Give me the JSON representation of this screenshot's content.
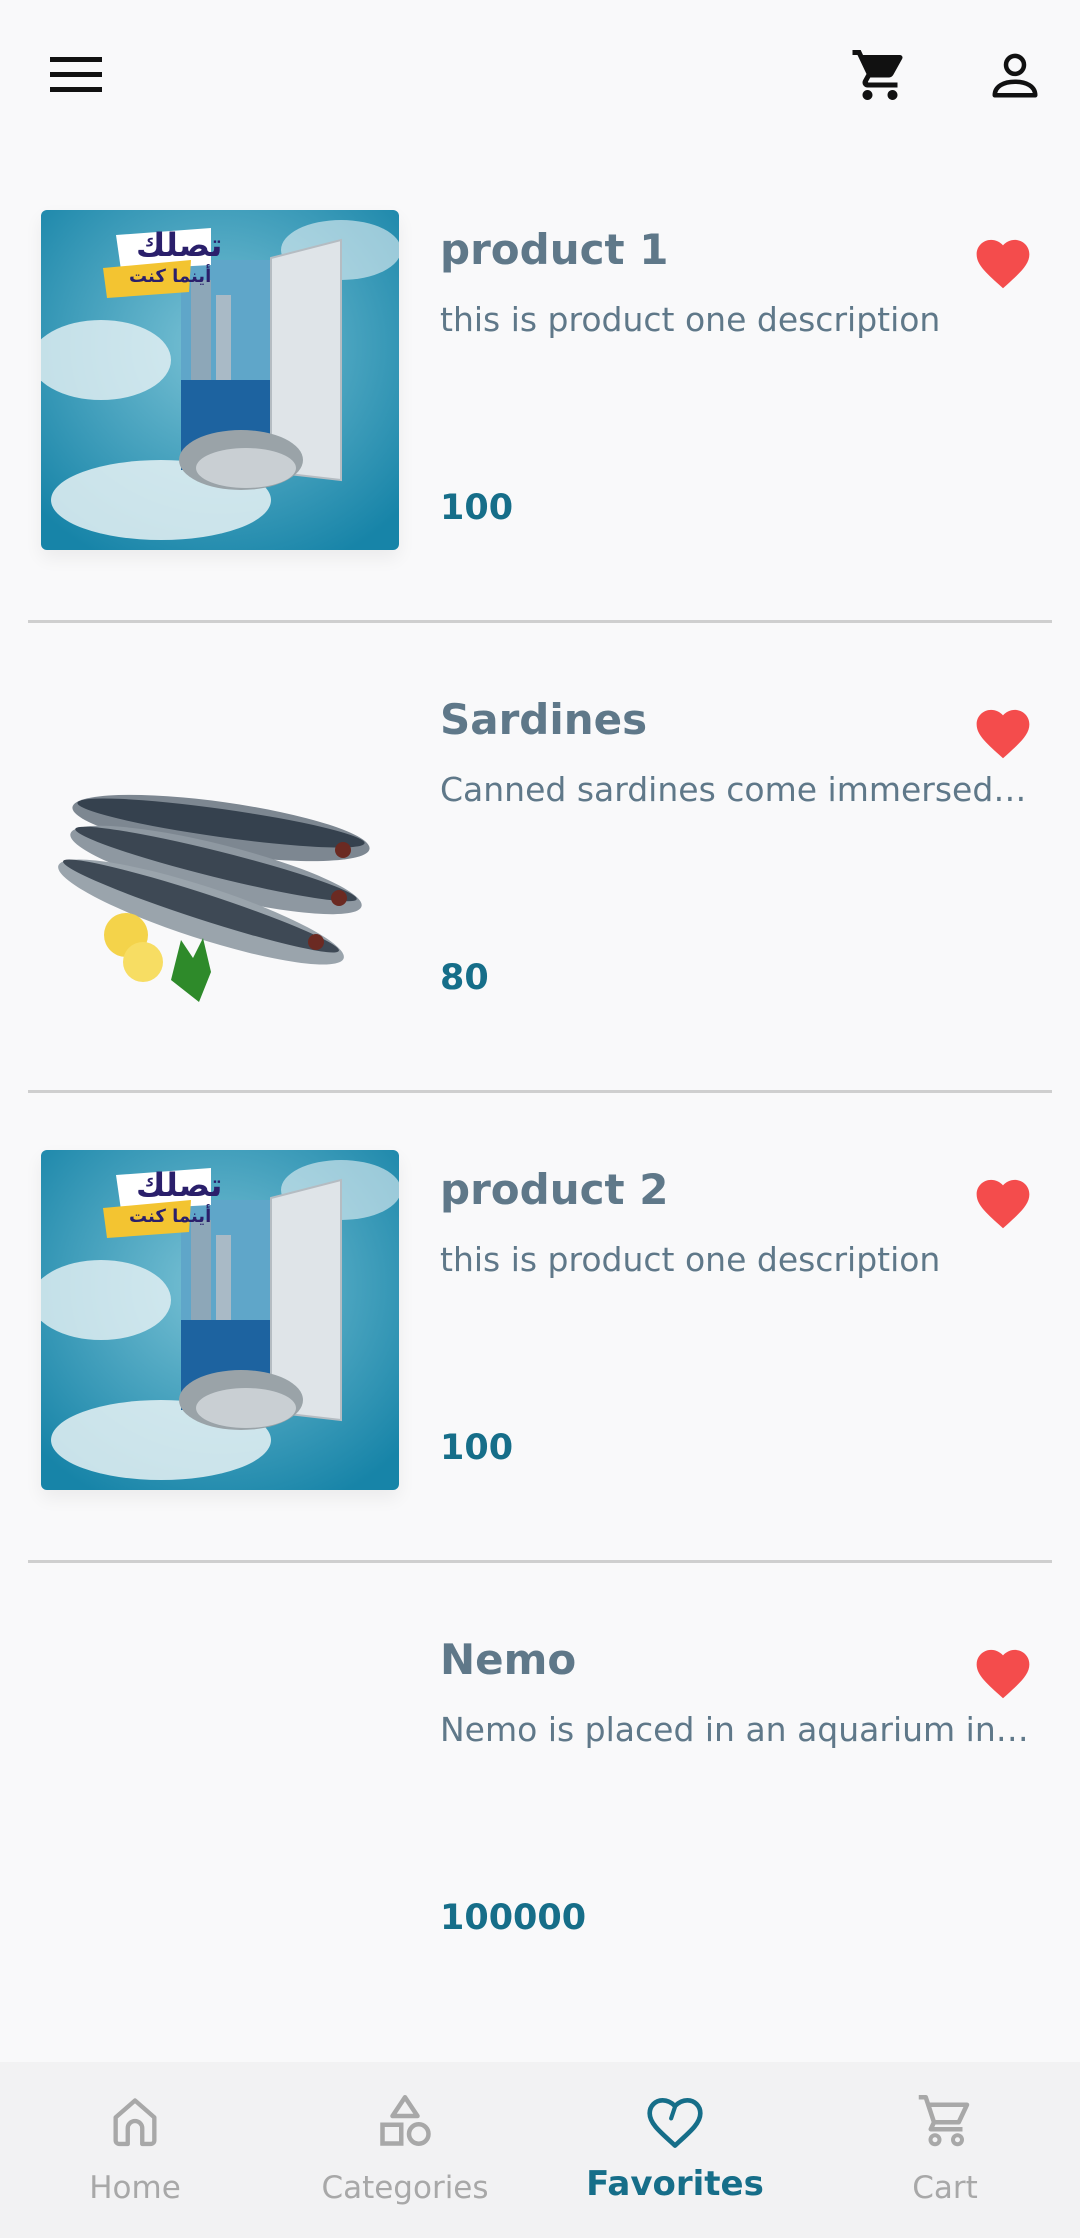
{
  "app": {
    "topbar": {
      "menu_icon": "menu-icon",
      "cart_icon": "cart-icon",
      "user_icon": "user-icon"
    },
    "colors": {
      "accent": "#166e89",
      "text": "#5f7889",
      "heart": "#f44c4c",
      "inactive": "#a8a8a8"
    }
  },
  "products": [
    {
      "name": "product 1",
      "description": "this is product one description",
      "price": "100",
      "image": "door-fish-ad"
    },
    {
      "name": "Sardines",
      "description": "Canned sardines come immersed in oil",
      "price": "80",
      "image": "sardines"
    },
    {
      "name": "product 2",
      "description": "this is product one description",
      "price": "100",
      "image": "door-fish-ad"
    },
    {
      "name": "Nemo",
      "description": "Nemo is placed in an aquarium in a dentist office",
      "price": "100000",
      "image": "blank"
    }
  ],
  "bottom_nav": {
    "items": [
      {
        "label": "Home",
        "icon": "home-icon"
      },
      {
        "label": "Categories",
        "icon": "categories-icon"
      },
      {
        "label": "Favorites",
        "icon": "heart-outline-icon",
        "active": true
      },
      {
        "label": "Cart",
        "icon": "cart-icon"
      }
    ]
  },
  "ad_text": {
    "line1": "تصلك",
    "line2": "أينما كنت"
  }
}
